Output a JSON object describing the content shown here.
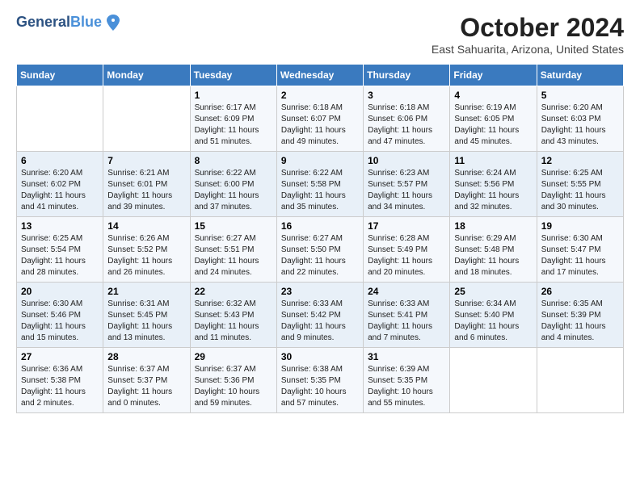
{
  "logo": {
    "line1": "General",
    "line2": "Blue"
  },
  "title": "October 2024",
  "location": "East Sahuarita, Arizona, United States",
  "days_of_week": [
    "Sunday",
    "Monday",
    "Tuesday",
    "Wednesday",
    "Thursday",
    "Friday",
    "Saturday"
  ],
  "weeks": [
    [
      {
        "day": "",
        "sunrise": "",
        "sunset": "",
        "daylight": ""
      },
      {
        "day": "",
        "sunrise": "",
        "sunset": "",
        "daylight": ""
      },
      {
        "day": "1",
        "sunrise": "Sunrise: 6:17 AM",
        "sunset": "Sunset: 6:09 PM",
        "daylight": "Daylight: 11 hours and 51 minutes."
      },
      {
        "day": "2",
        "sunrise": "Sunrise: 6:18 AM",
        "sunset": "Sunset: 6:07 PM",
        "daylight": "Daylight: 11 hours and 49 minutes."
      },
      {
        "day": "3",
        "sunrise": "Sunrise: 6:18 AM",
        "sunset": "Sunset: 6:06 PM",
        "daylight": "Daylight: 11 hours and 47 minutes."
      },
      {
        "day": "4",
        "sunrise": "Sunrise: 6:19 AM",
        "sunset": "Sunset: 6:05 PM",
        "daylight": "Daylight: 11 hours and 45 minutes."
      },
      {
        "day": "5",
        "sunrise": "Sunrise: 6:20 AM",
        "sunset": "Sunset: 6:03 PM",
        "daylight": "Daylight: 11 hours and 43 minutes."
      }
    ],
    [
      {
        "day": "6",
        "sunrise": "Sunrise: 6:20 AM",
        "sunset": "Sunset: 6:02 PM",
        "daylight": "Daylight: 11 hours and 41 minutes."
      },
      {
        "day": "7",
        "sunrise": "Sunrise: 6:21 AM",
        "sunset": "Sunset: 6:01 PM",
        "daylight": "Daylight: 11 hours and 39 minutes."
      },
      {
        "day": "8",
        "sunrise": "Sunrise: 6:22 AM",
        "sunset": "Sunset: 6:00 PM",
        "daylight": "Daylight: 11 hours and 37 minutes."
      },
      {
        "day": "9",
        "sunrise": "Sunrise: 6:22 AM",
        "sunset": "Sunset: 5:58 PM",
        "daylight": "Daylight: 11 hours and 35 minutes."
      },
      {
        "day": "10",
        "sunrise": "Sunrise: 6:23 AM",
        "sunset": "Sunset: 5:57 PM",
        "daylight": "Daylight: 11 hours and 34 minutes."
      },
      {
        "day": "11",
        "sunrise": "Sunrise: 6:24 AM",
        "sunset": "Sunset: 5:56 PM",
        "daylight": "Daylight: 11 hours and 32 minutes."
      },
      {
        "day": "12",
        "sunrise": "Sunrise: 6:25 AM",
        "sunset": "Sunset: 5:55 PM",
        "daylight": "Daylight: 11 hours and 30 minutes."
      }
    ],
    [
      {
        "day": "13",
        "sunrise": "Sunrise: 6:25 AM",
        "sunset": "Sunset: 5:54 PM",
        "daylight": "Daylight: 11 hours and 28 minutes."
      },
      {
        "day": "14",
        "sunrise": "Sunrise: 6:26 AM",
        "sunset": "Sunset: 5:52 PM",
        "daylight": "Daylight: 11 hours and 26 minutes."
      },
      {
        "day": "15",
        "sunrise": "Sunrise: 6:27 AM",
        "sunset": "Sunset: 5:51 PM",
        "daylight": "Daylight: 11 hours and 24 minutes."
      },
      {
        "day": "16",
        "sunrise": "Sunrise: 6:27 AM",
        "sunset": "Sunset: 5:50 PM",
        "daylight": "Daylight: 11 hours and 22 minutes."
      },
      {
        "day": "17",
        "sunrise": "Sunrise: 6:28 AM",
        "sunset": "Sunset: 5:49 PM",
        "daylight": "Daylight: 11 hours and 20 minutes."
      },
      {
        "day": "18",
        "sunrise": "Sunrise: 6:29 AM",
        "sunset": "Sunset: 5:48 PM",
        "daylight": "Daylight: 11 hours and 18 minutes."
      },
      {
        "day": "19",
        "sunrise": "Sunrise: 6:30 AM",
        "sunset": "Sunset: 5:47 PM",
        "daylight": "Daylight: 11 hours and 17 minutes."
      }
    ],
    [
      {
        "day": "20",
        "sunrise": "Sunrise: 6:30 AM",
        "sunset": "Sunset: 5:46 PM",
        "daylight": "Daylight: 11 hours and 15 minutes."
      },
      {
        "day": "21",
        "sunrise": "Sunrise: 6:31 AM",
        "sunset": "Sunset: 5:45 PM",
        "daylight": "Daylight: 11 hours and 13 minutes."
      },
      {
        "day": "22",
        "sunrise": "Sunrise: 6:32 AM",
        "sunset": "Sunset: 5:43 PM",
        "daylight": "Daylight: 11 hours and 11 minutes."
      },
      {
        "day": "23",
        "sunrise": "Sunrise: 6:33 AM",
        "sunset": "Sunset: 5:42 PM",
        "daylight": "Daylight: 11 hours and 9 minutes."
      },
      {
        "day": "24",
        "sunrise": "Sunrise: 6:33 AM",
        "sunset": "Sunset: 5:41 PM",
        "daylight": "Daylight: 11 hours and 7 minutes."
      },
      {
        "day": "25",
        "sunrise": "Sunrise: 6:34 AM",
        "sunset": "Sunset: 5:40 PM",
        "daylight": "Daylight: 11 hours and 6 minutes."
      },
      {
        "day": "26",
        "sunrise": "Sunrise: 6:35 AM",
        "sunset": "Sunset: 5:39 PM",
        "daylight": "Daylight: 11 hours and 4 minutes."
      }
    ],
    [
      {
        "day": "27",
        "sunrise": "Sunrise: 6:36 AM",
        "sunset": "Sunset: 5:38 PM",
        "daylight": "Daylight: 11 hours and 2 minutes."
      },
      {
        "day": "28",
        "sunrise": "Sunrise: 6:37 AM",
        "sunset": "Sunset: 5:37 PM",
        "daylight": "Daylight: 11 hours and 0 minutes."
      },
      {
        "day": "29",
        "sunrise": "Sunrise: 6:37 AM",
        "sunset": "Sunset: 5:36 PM",
        "daylight": "Daylight: 10 hours and 59 minutes."
      },
      {
        "day": "30",
        "sunrise": "Sunrise: 6:38 AM",
        "sunset": "Sunset: 5:35 PM",
        "daylight": "Daylight: 10 hours and 57 minutes."
      },
      {
        "day": "31",
        "sunrise": "Sunrise: 6:39 AM",
        "sunset": "Sunset: 5:35 PM",
        "daylight": "Daylight: 10 hours and 55 minutes."
      },
      {
        "day": "",
        "sunrise": "",
        "sunset": "",
        "daylight": ""
      },
      {
        "day": "",
        "sunrise": "",
        "sunset": "",
        "daylight": ""
      }
    ]
  ]
}
